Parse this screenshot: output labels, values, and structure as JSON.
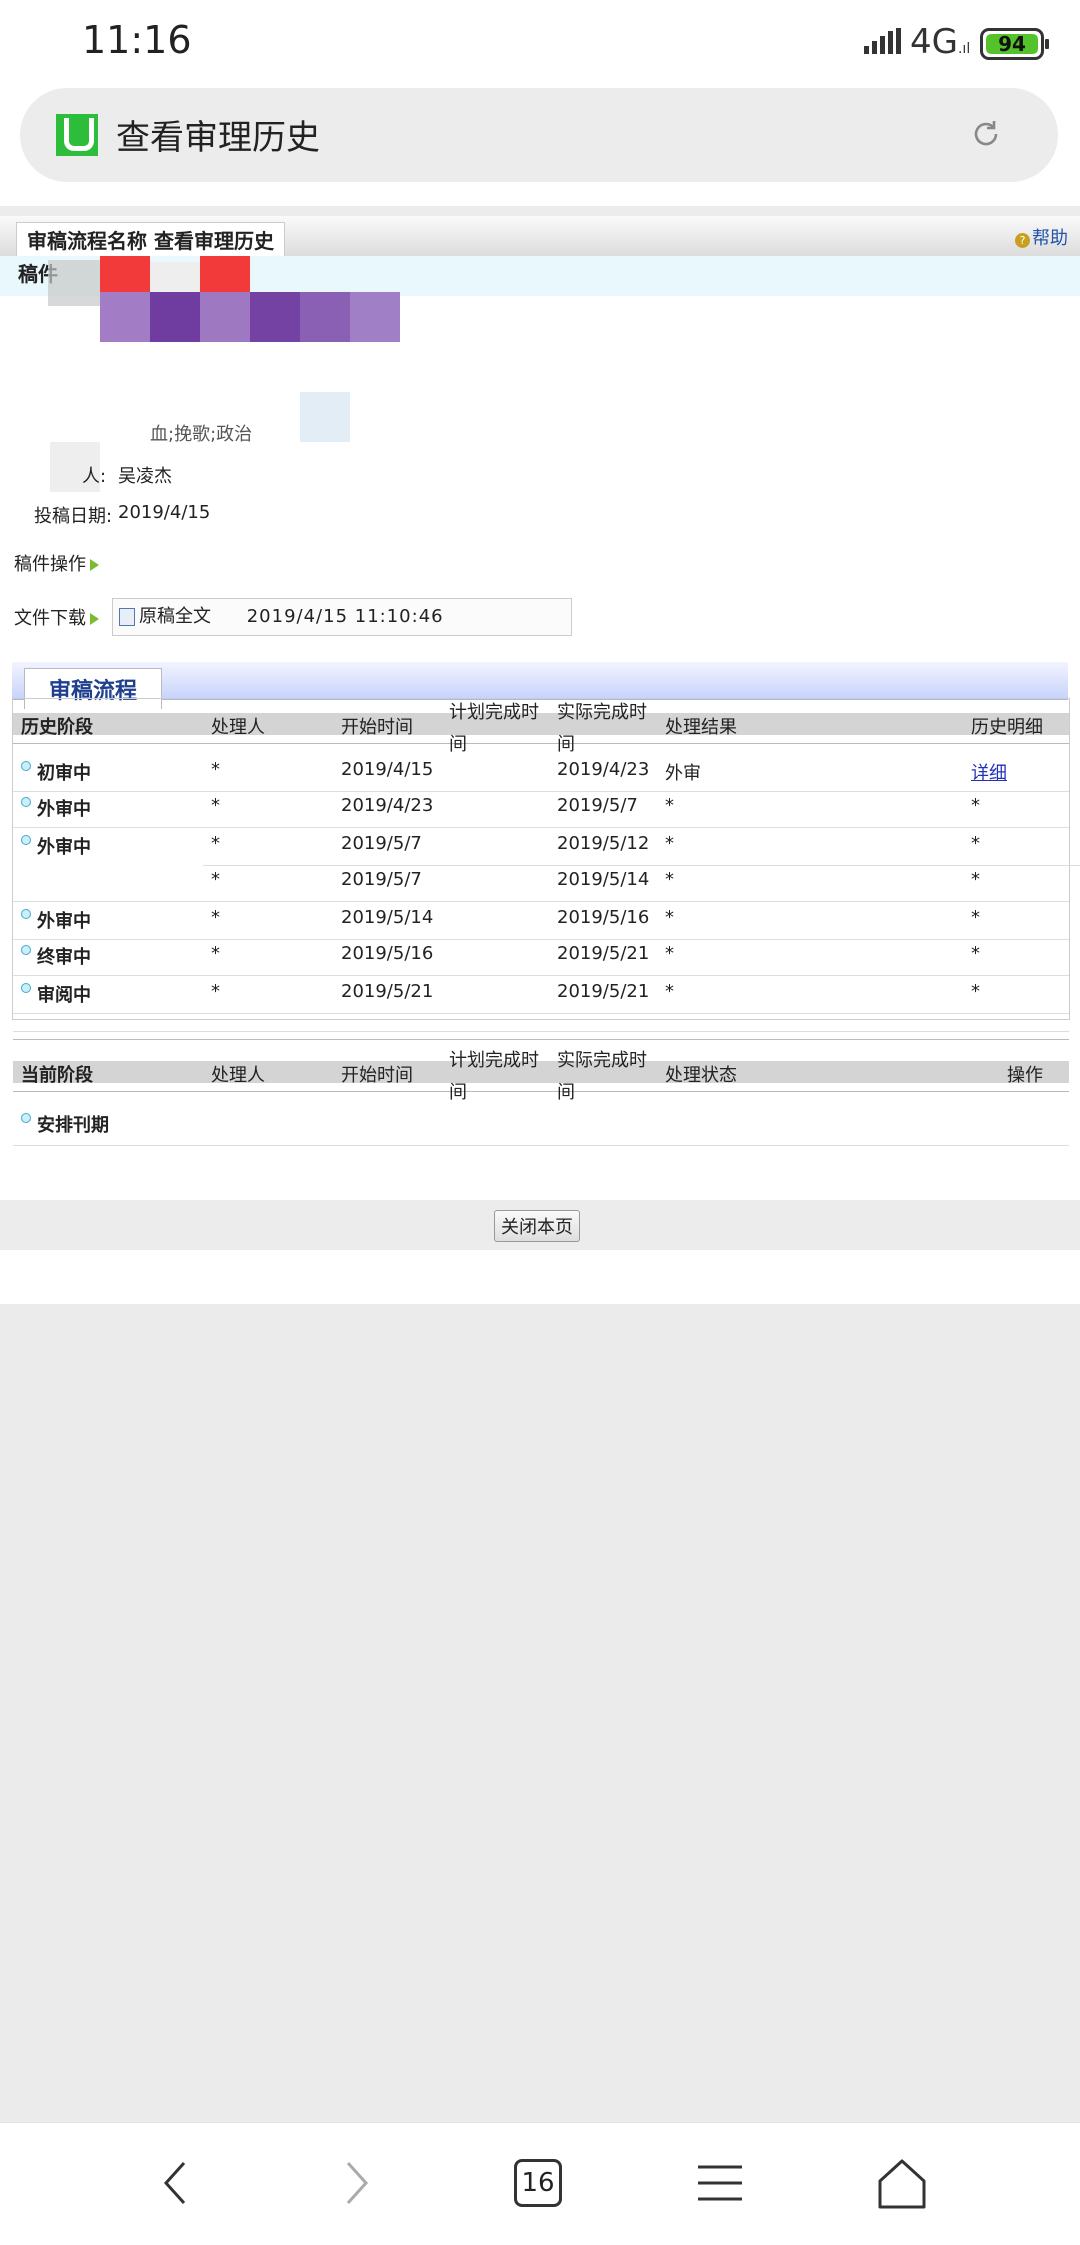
{
  "status": {
    "time": "11:16",
    "network": "4G",
    "battery": "94"
  },
  "browser": {
    "title": "查看审理历史"
  },
  "page": {
    "header_title": "审稿流程名称 查看审理历史",
    "help": "帮助",
    "manuscript_label": "稿件",
    "keywords_partial": "血;挽歌;政治",
    "author_label": "人:",
    "author": "吴凌杰",
    "date_label": "投稿日期:",
    "date": "2019/4/15",
    "ops_label": "稿件操作",
    "download_label": "文件下载",
    "download_file": "原稿全文",
    "download_time": "2019/4/15  11:10:46",
    "flow_tab": "审稿流程",
    "history_headers": {
      "stage": "历史阶段",
      "handler": "处理人",
      "start": "开始时间",
      "plan": "计划完成时间",
      "actual": "实际完成时间",
      "result": "处理结果",
      "detail": "历史明细"
    },
    "history_rows": [
      {
        "stage": "初审中",
        "handler": "*",
        "start": "2019/4/15",
        "actual": "2019/4/23",
        "result": "外审",
        "detail": "详细"
      },
      {
        "stage": "外审中",
        "handler": "*",
        "start": "2019/4/23",
        "actual": "2019/5/7",
        "result": "*",
        "detail": "*"
      },
      {
        "stage": "外审中",
        "handler": "*",
        "start": "2019/5/7",
        "actual": "2019/5/12",
        "result": "*",
        "detail": "*"
      },
      {
        "stage": "",
        "handler": "*",
        "start": "2019/5/7",
        "actual": "2019/5/14",
        "result": "*",
        "detail": "*"
      },
      {
        "stage": "外审中",
        "handler": "*",
        "start": "2019/5/14",
        "actual": "2019/5/16",
        "result": "*",
        "detail": "*"
      },
      {
        "stage": "终审中",
        "handler": "*",
        "start": "2019/5/16",
        "actual": "2019/5/21",
        "result": "*",
        "detail": "*"
      },
      {
        "stage": "审阅中",
        "handler": "*",
        "start": "2019/5/21",
        "actual": "2019/5/21",
        "result": "*",
        "detail": "*"
      }
    ],
    "current_headers": {
      "stage": "当前阶段",
      "handler": "处理人",
      "start": "开始时间",
      "plan": "计划完成时间",
      "actual": "实际完成时间",
      "status": "处理状态",
      "op": "操作"
    },
    "current_rows": [
      {
        "stage": "安排刊期"
      }
    ],
    "close_button": "关闭本页"
  },
  "navbar": {
    "tabs_count": "16"
  },
  "colors": {
    "accent": "#2ebd3a",
    "link": "#2233bb",
    "battery": "#54c22a"
  }
}
